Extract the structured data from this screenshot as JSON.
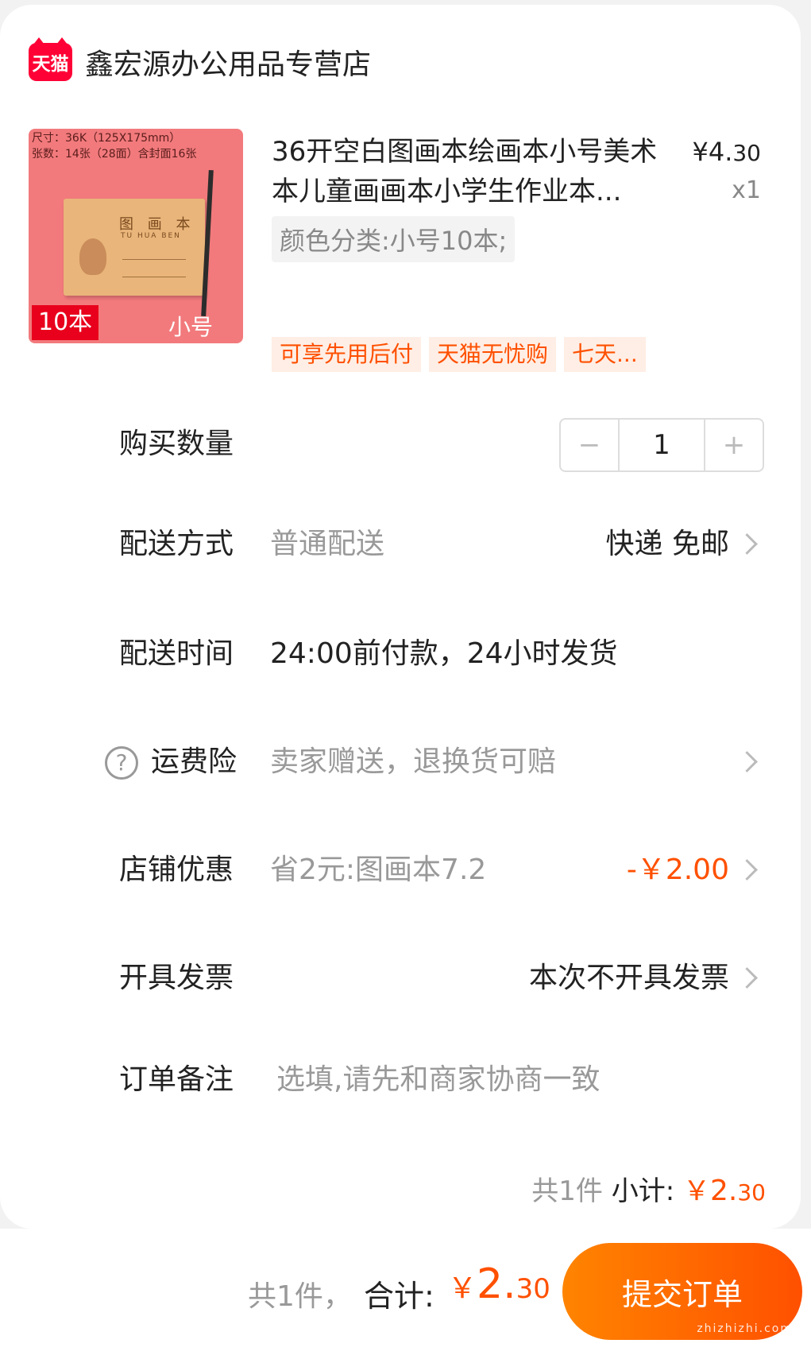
{
  "store": {
    "badge": "天猫",
    "name": "鑫宏源办公用品专营店"
  },
  "product": {
    "image": {
      "spec_line1": "尺寸：36K（125X175mm）",
      "spec_line2": "张数：14张（28面）含封面16张",
      "book_title": "图 画 本",
      "book_sub": "TU HUA BEN",
      "count_label": "10本",
      "size_label": "小号"
    },
    "title": "36开空白图画本绘画本小号美术本儿童画画本小学生作业本...",
    "price_yen": "¥4.",
    "price_cents": "30",
    "quantity": "x1",
    "variant": "颜色分类:小号10本;",
    "tags": [
      "可享先用后付",
      "天猫无忧购",
      "七天..."
    ]
  },
  "quantity_row": {
    "label": "购买数量",
    "minus": "−",
    "value": "1",
    "plus": "+"
  },
  "delivery_method": {
    "label": "配送方式",
    "value": "普通配送",
    "right": "快递 免邮"
  },
  "delivery_time": {
    "label": "配送时间",
    "value": "24:00前付款，24小时发货"
  },
  "shipping_insurance": {
    "help": "?",
    "label": "运费险",
    "value": "卖家赠送，退换货可赔"
  },
  "store_discount": {
    "label": "店铺优惠",
    "value": "省2元:图画本7.2",
    "right": "-￥2.00"
  },
  "invoice": {
    "label": "开具发票",
    "right": "本次不开具发票"
  },
  "order_note": {
    "label": "订单备注",
    "placeholder": "选填,请先和商家协商一致"
  },
  "subtotal": {
    "count": "共1件",
    "label": "小计:",
    "yen": "￥",
    "amount": "2.",
    "cents": "30"
  },
  "footer": {
    "count": "共1件，",
    "total_label": "合计:",
    "yen": "￥",
    "amount": "2.",
    "cents": "30",
    "submit_label": "提交订单",
    "watermark": "zhizhizhi.com"
  },
  "colors": {
    "accent": "#ff5000",
    "tmall_red": "#ff0036"
  }
}
